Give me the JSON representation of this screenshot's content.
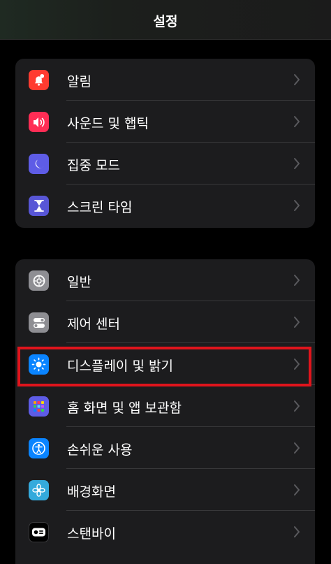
{
  "nav": {
    "title": "설정"
  },
  "group1": [
    {
      "label": "알림",
      "icon": "notifications-icon",
      "color": "#ff3b30"
    },
    {
      "label": "사운드 및 햅틱",
      "icon": "sound-icon",
      "color": "#ff2d55"
    },
    {
      "label": "집중 모드",
      "icon": "moon-icon",
      "color": "#5e5ce6"
    },
    {
      "label": "스크린 타임",
      "icon": "hourglass-icon",
      "color": "#5856d6"
    }
  ],
  "group2": [
    {
      "label": "일반",
      "icon": "gear-icon",
      "color": "#8e8e93"
    },
    {
      "label": "제어 센터",
      "icon": "toggles-icon",
      "color": "#8e8e93"
    },
    {
      "label": "디스플레이 및 밝기",
      "icon": "sun-icon",
      "color": "#0a84ff"
    },
    {
      "label": "홈 화면 및 앱 보관함",
      "icon": "app-grid-icon",
      "color": "#5e5ce6"
    },
    {
      "label": "손쉬운 사용",
      "icon": "accessibility-icon",
      "color": "#0a84ff"
    },
    {
      "label": "배경화면",
      "icon": "flower-icon",
      "color": "#34aadc"
    },
    {
      "label": "스탠바이",
      "icon": "standby-icon",
      "color": "#1c1c1e"
    }
  ],
  "highlight": {
    "color": "#e0141c",
    "target": "디스플레이 및 밝기"
  }
}
